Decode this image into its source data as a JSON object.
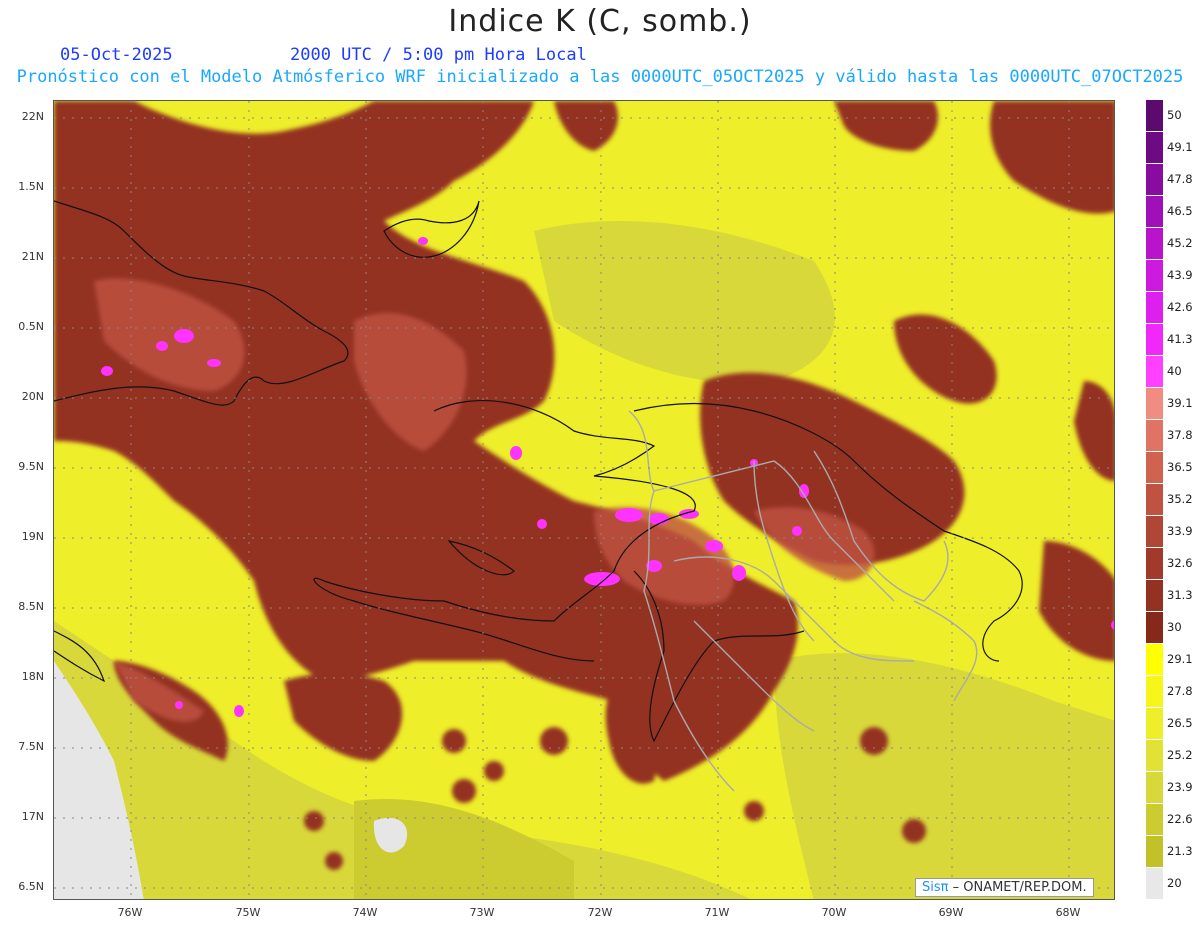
{
  "title": "Indice K (C, somb.)",
  "date": "05-Oct-2025",
  "time_label": "2000 UTC / 5:00 pm Hora Local",
  "forecast_label": "Pronóstico con el Modelo Atmósferico WRF inicializado a las 0000UTC_05OCT2025 y válido hasta las  0000UTC_07OCT2025",
  "lat_labels": [
    "22N",
    "1.5N",
    "21N",
    "0.5N",
    "20N",
    "9.5N",
    "19N",
    "8.5N",
    "18N",
    "7.5N",
    "17N",
    "6.5N"
  ],
  "lon_labels": [
    "76W",
    "75W",
    "74W",
    "73W",
    "72W",
    "71W",
    "70W",
    "69W",
    "68W"
  ],
  "colorbar": {
    "labels": [
      "50",
      "49.1",
      "47.8",
      "46.5",
      "45.2",
      "43.9",
      "42.6",
      "41.3",
      "40",
      "39.1",
      "37.8",
      "36.5",
      "35.2",
      "33.9",
      "32.6",
      "31.3",
      "30",
      "29.1",
      "27.8",
      "26.5",
      "25.2",
      "23.9",
      "22.6",
      "21.3",
      "20"
    ],
    "colors": [
      "#5c0a6e",
      "#6e0a82",
      "#880ca0",
      "#a010b8",
      "#b814cc",
      "#cc1ade",
      "#de20ee",
      "#f028fa",
      "#ff40ff",
      "#f08c80",
      "#e07464",
      "#d06250",
      "#c05242",
      "#b04636",
      "#a23a2c",
      "#943222",
      "#86281a",
      "#ffff00",
      "#f6f61a",
      "#eeee2a",
      "#e2e236",
      "#d8d83a",
      "#cccc30",
      "#c2c228",
      "#e8e8e8"
    ]
  },
  "credit": {
    "brand": "Sisπ",
    "text": " – ONAMET/REP.DOM."
  }
}
